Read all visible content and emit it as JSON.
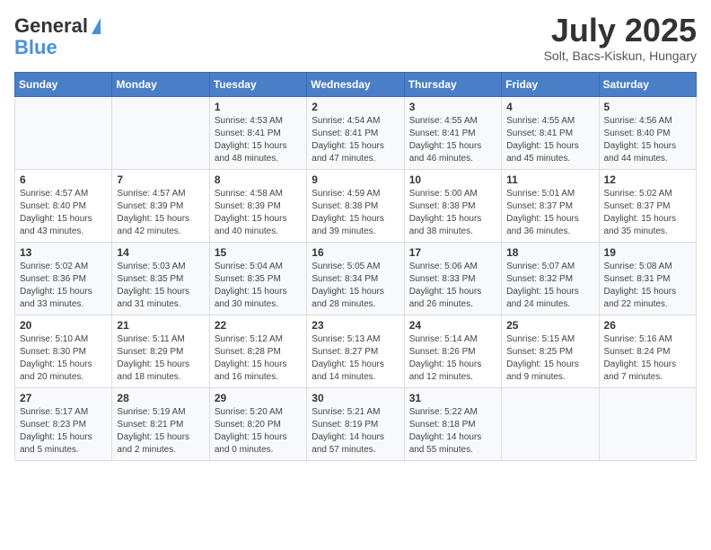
{
  "header": {
    "logo_general": "General",
    "logo_blue": "Blue",
    "month_year": "July 2025",
    "location": "Solt, Bacs-Kiskun, Hungary"
  },
  "days_of_week": [
    "Sunday",
    "Monday",
    "Tuesday",
    "Wednesday",
    "Thursday",
    "Friday",
    "Saturday"
  ],
  "weeks": [
    [
      {
        "day": "",
        "info": ""
      },
      {
        "day": "",
        "info": ""
      },
      {
        "day": "1",
        "info": "Sunrise: 4:53 AM\nSunset: 8:41 PM\nDaylight: 15 hours\nand 48 minutes."
      },
      {
        "day": "2",
        "info": "Sunrise: 4:54 AM\nSunset: 8:41 PM\nDaylight: 15 hours\nand 47 minutes."
      },
      {
        "day": "3",
        "info": "Sunrise: 4:55 AM\nSunset: 8:41 PM\nDaylight: 15 hours\nand 46 minutes."
      },
      {
        "day": "4",
        "info": "Sunrise: 4:55 AM\nSunset: 8:41 PM\nDaylight: 15 hours\nand 45 minutes."
      },
      {
        "day": "5",
        "info": "Sunrise: 4:56 AM\nSunset: 8:40 PM\nDaylight: 15 hours\nand 44 minutes."
      }
    ],
    [
      {
        "day": "6",
        "info": "Sunrise: 4:57 AM\nSunset: 8:40 PM\nDaylight: 15 hours\nand 43 minutes."
      },
      {
        "day": "7",
        "info": "Sunrise: 4:57 AM\nSunset: 8:39 PM\nDaylight: 15 hours\nand 42 minutes."
      },
      {
        "day": "8",
        "info": "Sunrise: 4:58 AM\nSunset: 8:39 PM\nDaylight: 15 hours\nand 40 minutes."
      },
      {
        "day": "9",
        "info": "Sunrise: 4:59 AM\nSunset: 8:38 PM\nDaylight: 15 hours\nand 39 minutes."
      },
      {
        "day": "10",
        "info": "Sunrise: 5:00 AM\nSunset: 8:38 PM\nDaylight: 15 hours\nand 38 minutes."
      },
      {
        "day": "11",
        "info": "Sunrise: 5:01 AM\nSunset: 8:37 PM\nDaylight: 15 hours\nand 36 minutes."
      },
      {
        "day": "12",
        "info": "Sunrise: 5:02 AM\nSunset: 8:37 PM\nDaylight: 15 hours\nand 35 minutes."
      }
    ],
    [
      {
        "day": "13",
        "info": "Sunrise: 5:02 AM\nSunset: 8:36 PM\nDaylight: 15 hours\nand 33 minutes."
      },
      {
        "day": "14",
        "info": "Sunrise: 5:03 AM\nSunset: 8:35 PM\nDaylight: 15 hours\nand 31 minutes."
      },
      {
        "day": "15",
        "info": "Sunrise: 5:04 AM\nSunset: 8:35 PM\nDaylight: 15 hours\nand 30 minutes."
      },
      {
        "day": "16",
        "info": "Sunrise: 5:05 AM\nSunset: 8:34 PM\nDaylight: 15 hours\nand 28 minutes."
      },
      {
        "day": "17",
        "info": "Sunrise: 5:06 AM\nSunset: 8:33 PM\nDaylight: 15 hours\nand 26 minutes."
      },
      {
        "day": "18",
        "info": "Sunrise: 5:07 AM\nSunset: 8:32 PM\nDaylight: 15 hours\nand 24 minutes."
      },
      {
        "day": "19",
        "info": "Sunrise: 5:08 AM\nSunset: 8:31 PM\nDaylight: 15 hours\nand 22 minutes."
      }
    ],
    [
      {
        "day": "20",
        "info": "Sunrise: 5:10 AM\nSunset: 8:30 PM\nDaylight: 15 hours\nand 20 minutes."
      },
      {
        "day": "21",
        "info": "Sunrise: 5:11 AM\nSunset: 8:29 PM\nDaylight: 15 hours\nand 18 minutes."
      },
      {
        "day": "22",
        "info": "Sunrise: 5:12 AM\nSunset: 8:28 PM\nDaylight: 15 hours\nand 16 minutes."
      },
      {
        "day": "23",
        "info": "Sunrise: 5:13 AM\nSunset: 8:27 PM\nDaylight: 15 hours\nand 14 minutes."
      },
      {
        "day": "24",
        "info": "Sunrise: 5:14 AM\nSunset: 8:26 PM\nDaylight: 15 hours\nand 12 minutes."
      },
      {
        "day": "25",
        "info": "Sunrise: 5:15 AM\nSunset: 8:25 PM\nDaylight: 15 hours\nand 9 minutes."
      },
      {
        "day": "26",
        "info": "Sunrise: 5:16 AM\nSunset: 8:24 PM\nDaylight: 15 hours\nand 7 minutes."
      }
    ],
    [
      {
        "day": "27",
        "info": "Sunrise: 5:17 AM\nSunset: 8:23 PM\nDaylight: 15 hours\nand 5 minutes."
      },
      {
        "day": "28",
        "info": "Sunrise: 5:19 AM\nSunset: 8:21 PM\nDaylight: 15 hours\nand 2 minutes."
      },
      {
        "day": "29",
        "info": "Sunrise: 5:20 AM\nSunset: 8:20 PM\nDaylight: 15 hours\nand 0 minutes."
      },
      {
        "day": "30",
        "info": "Sunrise: 5:21 AM\nSunset: 8:19 PM\nDaylight: 14 hours\nand 57 minutes."
      },
      {
        "day": "31",
        "info": "Sunrise: 5:22 AM\nSunset: 8:18 PM\nDaylight: 14 hours\nand 55 minutes."
      },
      {
        "day": "",
        "info": ""
      },
      {
        "day": "",
        "info": ""
      }
    ]
  ]
}
